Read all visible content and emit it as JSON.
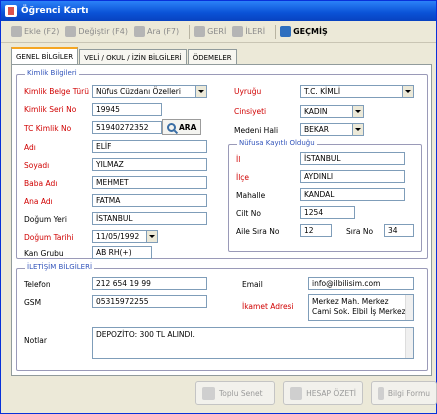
{
  "window": {
    "title": "Öğrenci Kartı"
  },
  "toolbar": {
    "buttons": [
      "Ekle (F2)",
      "Değiştir (F4)",
      "Ara (F7)",
      "GERİ",
      "İLERİ",
      "GEÇMİŞ"
    ]
  },
  "tabs": [
    "GENEL BİLGİLER",
    "VELİ / OKUL / İZİN BİLGİLERİ",
    "ÖDEMELER"
  ],
  "kimlik": {
    "title": "Kimlik Bilgileri",
    "kurum_label": "Kimlik Belge Türü",
    "kurum_value": "Nüfus Cüzdanı Özelleri",
    "seri_label": "Kimlik Seri No",
    "seri_value": "19945",
    "tc_label": "TC Kimlik No",
    "tc_value": "51940272352",
    "ara_label": "ARA",
    "adi_label": "Adı",
    "adi_value": "ELİF",
    "soyadi_label": "Soyadı",
    "soyadi_value": "YILMAZ",
    "baba_label": "Baba Adı",
    "baba_value": "MEHMET",
    "ana_label": "Ana Adı",
    "ana_value": "FATMA",
    "dogum_yeri_label": "Doğum Yeri",
    "dogum_yeri_value": "İSTANBUL",
    "dogum_tarihi_label": "Doğum Tarihi",
    "dogum_tarihi_value": "11/05/1992",
    "kan_label": "Kan Grubu",
    "kan_value": "AB RH(+)",
    "uyruk_label": "Uyruğu",
    "uyruk_value": "T.C. KİMLİ",
    "cinsiyet_label": "Cinsiyeti",
    "cinsiyet_value": "KADIN",
    "medeni_label": "Medeni Hali",
    "medeni_value": "BEKAR"
  },
  "nufus": {
    "title": "Nüfusa Kayıtlı Olduğu",
    "il_label": "İl",
    "il_value": "İSTANBUL",
    "ilce_label": "İlçe",
    "ilce_value": "AYDINLI",
    "mahalle_label": "Mahalle",
    "mahalle_value": "KANDAL",
    "cilt_label": "Cilt No",
    "cilt_value": "1254",
    "aile_label": "Aile Sıra No",
    "aile_value": "12",
    "sira_label": "Sıra No",
    "sira_value": "34"
  },
  "iletisim": {
    "title": "İLETİŞİM BİLGİLERİ",
    "telefon_label": "Telefon",
    "telefon_value": "212 654 19 99",
    "gsm_label": "GSM",
    "gsm_value": "05315972255",
    "email_label": "Email",
    "email_value": "info@ilbilisim.com",
    "adres_label": "İkamet Adresi",
    "adres_value": "Merkez Mah. Merkez\nCami Sok. Elbil İş Merkezi",
    "notlar_label": "Notlar",
    "notlar_value": "DEPOZİTO: 300 TL ALINDI."
  },
  "bottom": {
    "buttons": [
      "Toplu Senet",
      "HESAP ÖZETİ",
      "Bilgi Formu"
    ]
  }
}
